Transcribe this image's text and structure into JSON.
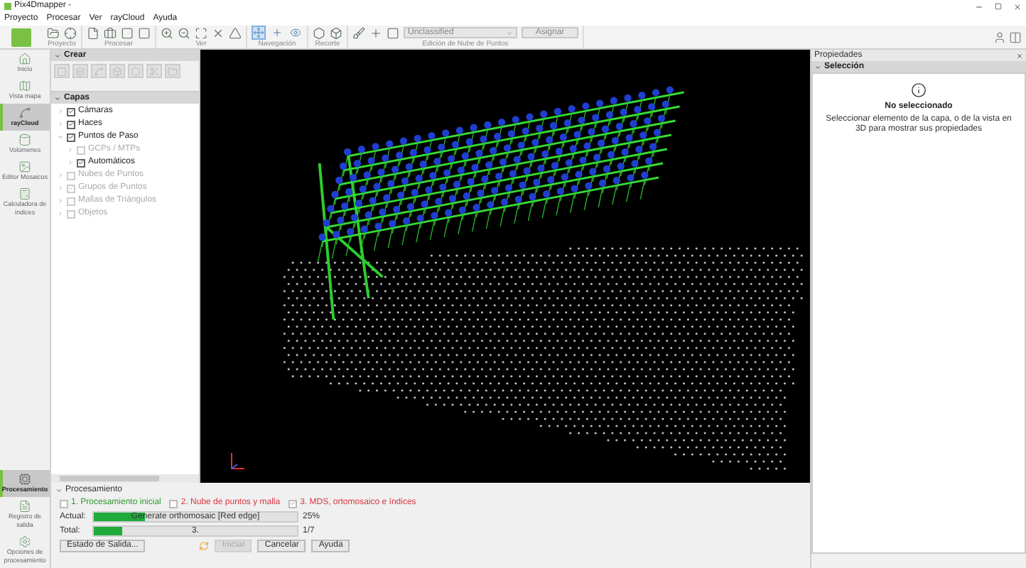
{
  "window": {
    "title": "Pix4Dmapper -"
  },
  "menu": [
    "Proyecto",
    "Procesar",
    "Ver",
    "rayCloud",
    "Ayuda"
  ],
  "ribbon": {
    "groups": [
      {
        "label": "Proyecto"
      },
      {
        "label": "Procesar"
      },
      {
        "label": "Ver"
      },
      {
        "label": "Navegación"
      },
      {
        "label": "Recorte"
      },
      {
        "label": "Edición de Nube de Puntos"
      }
    ],
    "nav_tools": [
      {
        "selected": true
      },
      {
        "selected": false
      },
      {
        "selected": false
      }
    ],
    "class_select": {
      "value": "Unclassified"
    },
    "assign_button": "Asignar"
  },
  "sidebar": {
    "top": [
      {
        "label": "Inicio",
        "selected": false
      },
      {
        "label": "Vista mapa",
        "selected": false
      },
      {
        "label": "rayCloud",
        "selected": true
      },
      {
        "label": "Volúmenes",
        "selected": false
      },
      {
        "label": "Editor Mosaicos",
        "selected": false
      },
      {
        "label": "Calculadora de índices",
        "selected": false
      }
    ],
    "bottom": [
      {
        "label": "Procesamiento",
        "selected": true
      },
      {
        "label": "Registro de salida",
        "selected": false
      },
      {
        "label": "Opciones de procesamiento",
        "selected": false
      }
    ]
  },
  "create_panel": {
    "title": "Crear"
  },
  "layers": {
    "title": "Capas",
    "items": [
      {
        "label": "Cámaras",
        "checked": true,
        "disabled": false,
        "expanded": false
      },
      {
        "label": "Haces",
        "checked": true,
        "disabled": false,
        "expanded": false
      },
      {
        "label": "Puntos de Paso",
        "checked": true,
        "disabled": false,
        "expanded": true,
        "children": [
          {
            "label": "GCPs / MTPs",
            "checked": false,
            "disabled": true,
            "expanded": false
          },
          {
            "label": "Automáticos",
            "checked": true,
            "disabled": false,
            "expanded": false
          }
        ]
      },
      {
        "label": "Nubes de Puntos",
        "checked": false,
        "disabled": true,
        "expanded": false
      },
      {
        "label": "Grupos de Puntos",
        "checked": true,
        "disabled": true,
        "expanded": false
      },
      {
        "label": "Mallas de Triángulos",
        "checked": false,
        "disabled": true,
        "expanded": false
      },
      {
        "label": "Objetos",
        "checked": false,
        "disabled": true,
        "expanded": false
      }
    ]
  },
  "properties": {
    "title": "Propiedades",
    "section": "Selección",
    "heading": "No seleccionado",
    "message": "Seleccionar elemento de la capa, o de la vista en 3D para mostrar sus propiedades"
  },
  "processing": {
    "title": "Procesamiento",
    "steps": [
      {
        "label": "1. Procesamiento inicial",
        "checked": false,
        "color": "#2e9b2e"
      },
      {
        "label": "2. Nube de puntos y malla",
        "checked": false,
        "color": "#d9363e"
      },
      {
        "label": "3. MDS, ortomosaico e índices",
        "checked": true,
        "color": "#d9363e"
      }
    ],
    "bars": [
      {
        "label": "Actual:",
        "text": "Generate orthomosaic [Red edge]",
        "level": 0.25,
        "reading": "25%"
      },
      {
        "label": "Total:",
        "text": "3.",
        "level": 0.14,
        "reading": "1/7"
      }
    ],
    "buttons": [
      {
        "label": "Estado de Salida...",
        "disabled": false
      },
      {
        "label": "Iniciar",
        "disabled": true
      },
      {
        "label": "Cancelar",
        "disabled": false
      },
      {
        "label": "Ayuda",
        "disabled": false
      }
    ]
  }
}
